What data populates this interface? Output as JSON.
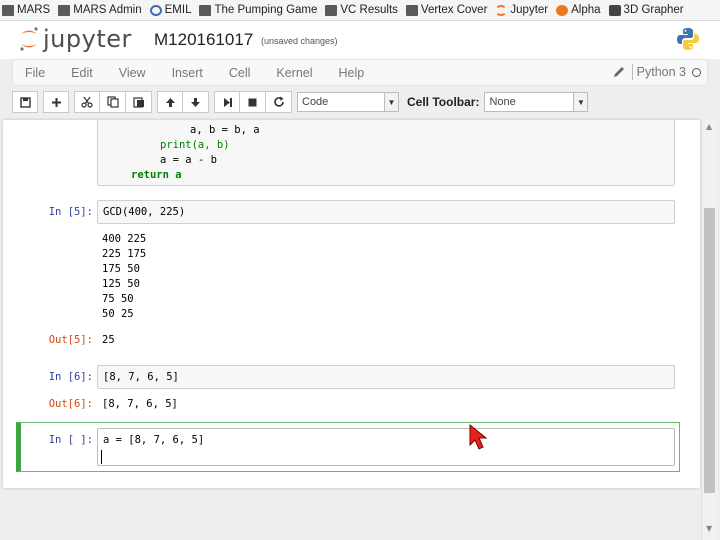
{
  "bookmarks": [
    {
      "label": "MARS",
      "icon": "folder-icon"
    },
    {
      "label": "MARS Admin",
      "icon": "folder-icon"
    },
    {
      "label": "EMIL",
      "icon": "globe-icon"
    },
    {
      "label": "The Pumping Game",
      "icon": "folder-icon"
    },
    {
      "label": "VC Results",
      "icon": "folder-icon"
    },
    {
      "label": "Vertex Cover",
      "icon": "folder-icon"
    },
    {
      "label": "Jupyter",
      "icon": "jupyter-icon"
    },
    {
      "label": "Alpha",
      "icon": "alpha-icon"
    },
    {
      "label": "3D Grapher",
      "icon": "grapher-icon"
    }
  ],
  "header": {
    "logo_text": "jupyter",
    "notebook_name": "M120161017",
    "save_status": "(unsaved changes)"
  },
  "menubar": {
    "items": [
      "File",
      "Edit",
      "View",
      "Insert",
      "Cell",
      "Kernel",
      "Help"
    ],
    "kernel_name": "Python 3"
  },
  "toolbar": {
    "cell_type": "Code",
    "cell_toolbar_label": "Cell Toolbar:",
    "cell_toolbar_value": "None"
  },
  "cells": {
    "cell1": {
      "lines": [
        "a, b = b, a",
        "print(a, b)",
        "a = a - b",
        "return a"
      ]
    },
    "cell2": {
      "in_prompt": "In [5]:",
      "code": "GCD(400, 225)",
      "stdout": [
        "400 225",
        "225 175",
        "175 50",
        "125 50",
        "75 50",
        "50 25"
      ],
      "out_prompt": "Out[5]:",
      "result": "25"
    },
    "cell3": {
      "in_prompt": "In [6]:",
      "code": "[8, 7, 6, 5]",
      "out_prompt": "Out[6]:",
      "result": "[8, 7, 6, 5]"
    },
    "cell4": {
      "in_prompt": "In [ ]:",
      "code": "a = [8, 7, 6, 5]"
    }
  },
  "colors": {
    "in_prompt": "#303f9f",
    "out_prompt": "#d84315",
    "selected_border": "#42a545",
    "cursor": "#e8211b"
  }
}
